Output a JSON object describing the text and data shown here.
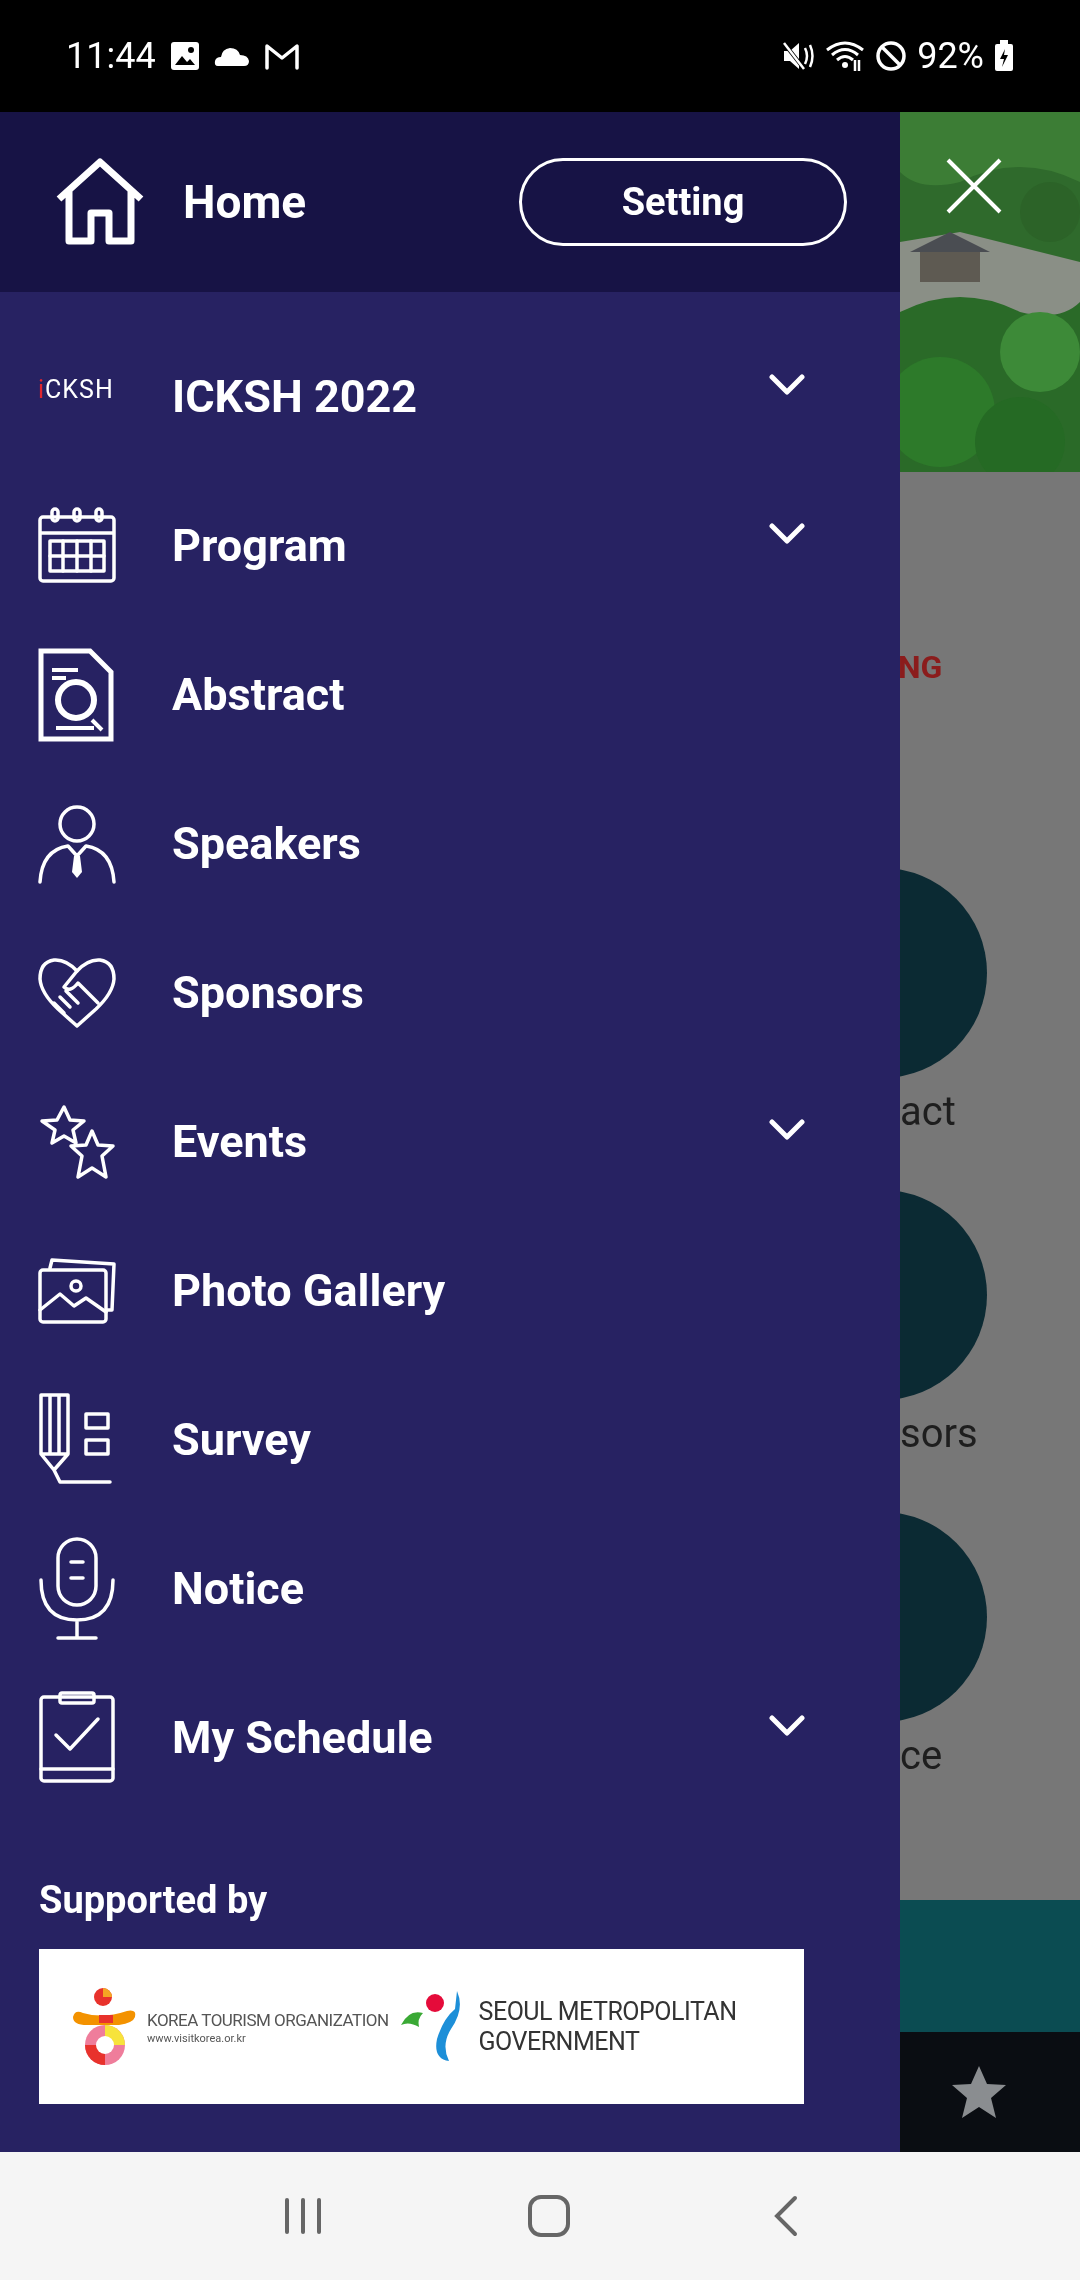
{
  "status_bar": {
    "time": "11:44",
    "battery": "92%"
  },
  "header": {
    "home": "Home",
    "setting_button": "Setting"
  },
  "menu": [
    {
      "kind": "logo",
      "logo_text": "iCKSH",
      "label": "ICKSH 2022",
      "expandable": true
    },
    {
      "kind": "calendar",
      "label": "Program",
      "expandable": true
    },
    {
      "kind": "document",
      "label": "Abstract",
      "expandable": false
    },
    {
      "kind": "person",
      "label": "Speakers",
      "expandable": false
    },
    {
      "kind": "handshake",
      "label": "Sponsors",
      "expandable": false
    },
    {
      "kind": "stars",
      "label": "Events",
      "expandable": true
    },
    {
      "kind": "photos",
      "label": "Photo Gallery",
      "expandable": false
    },
    {
      "kind": "survey",
      "label": "Survey",
      "expandable": false
    },
    {
      "kind": "microphone",
      "label": "Notice",
      "expandable": false
    },
    {
      "kind": "clipboard",
      "label": "My Schedule",
      "expandable": true
    }
  ],
  "supported_by": {
    "title": "Supported by",
    "sponsors": [
      {
        "kind": "kto",
        "lines": [
          "KOREA TOURISM ORGANIZATION",
          "www.visitkorea.or.kr"
        ]
      },
      {
        "kind": "seoul",
        "lines": [
          "SEOUL METROPOLITAN",
          "GOVERNMENT"
        ]
      }
    ]
  },
  "background_page": {
    "heading_fragment": "NG",
    "button_labels": [
      "act",
      "sors",
      "ce"
    ]
  }
}
